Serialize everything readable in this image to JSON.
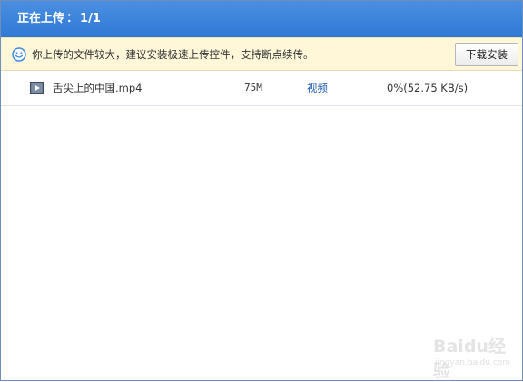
{
  "title": {
    "label": "正在上传",
    "separator": "：",
    "count": "1/1"
  },
  "notice": {
    "icon": "smile-icon",
    "text": "你上传的文件较大，建议安装极速上传控件，支持断点续传。",
    "button_label": "下载安装"
  },
  "files": [
    {
      "icon": "video-file-icon",
      "name": "舌尖上的中国.mp4",
      "size": "75M",
      "type": "视频",
      "progress": "0%(52.75 KB/s)"
    }
  ],
  "watermark": {
    "logo": "Baidu经验",
    "url": "jingyan.baidu.com"
  },
  "colors": {
    "titlebar": "#3a82dc",
    "notice_bg": "#fff7d7",
    "link": "#1f5fb0"
  }
}
